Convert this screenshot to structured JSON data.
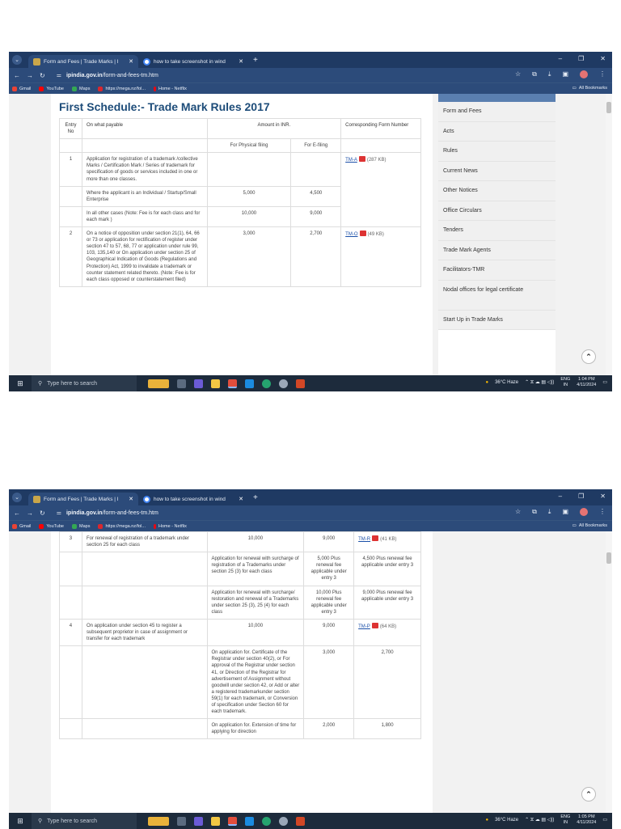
{
  "browser": {
    "tabs": [
      {
        "title": "Form and Fees | Trade Marks | I",
        "active": true
      },
      {
        "title": "how to take screenshot in wind",
        "active": false
      }
    ],
    "url_host": "ipindia.gov.in",
    "url_path": "/form-and-fees-tm.htm",
    "bookmarks": [
      "Gmail",
      "YouTube",
      "Maps",
      "https://mega.nz/fol...",
      "Home - Netflix"
    ],
    "all_bookmarks": "All Bookmarks"
  },
  "page1": {
    "heading": "First Schedule:- Trade Mark Rules 2017",
    "headers": {
      "entry": "Entry No",
      "what": "On what payable",
      "amount": "Amount in INR.",
      "form": "Corresponding Form Number",
      "physical": "For Physical filing",
      "efiling": "For E-filing"
    },
    "rows": [
      {
        "no": "1",
        "what": "Application for registration of a trademark /collective Marks / Certification Mark / Series of trademark for specification of goods or services included in one or more than one classes.",
        "phys": "",
        "efile": "",
        "form": "TM-A",
        "size": "(287 KB)"
      },
      {
        "no": "",
        "what": "Where the applicant is an Individual / Startup/Small Enterprise",
        "phys": "5,000",
        "efile": "4,500",
        "form": "",
        "size": ""
      },
      {
        "no": "",
        "what": "In all other cases (Note: Fee is for each class and for each mark )",
        "phys": "10,000",
        "efile": "9,000",
        "form": "",
        "size": ""
      },
      {
        "no": "2",
        "what": "On a notice of opposition under section 21(1), 64, 66 or 73 or application for rectification of register under section 47 to 57, 68, 77 or application under rule 99, 103, 135,140 or On application under section 25 of Geographical Indication of Goods (Regulations and Protection) Act, 1999 to invalidate a trademark or counter statement related thereto. (Note: Fee is for each class opposed or counterstatement filed)",
        "phys": "3,000",
        "efile": "2,700",
        "form": "TM-O",
        "size": "(49 KB)"
      }
    ]
  },
  "sidebar": [
    "Form and Fees",
    "Acts",
    "Rules",
    "Current News",
    "Other Notices",
    "Office Circulars",
    "Tenders",
    "Trade Mark Agents",
    "Facilitators-TMR",
    "Nodal offices for legal certificate",
    "Start Up in Trade Marks"
  ],
  "page2": {
    "rows": [
      {
        "no": "3",
        "what": "For renewal of registration of a trademark under section 25 for each class",
        "phys": "10,000",
        "efile": "9,000",
        "form": "TM-R",
        "size": "(41 KB)"
      },
      {
        "no": "",
        "what": "Application for renewal with surcharge of registration of a Trademarks under section 25 (3) for each class",
        "phys": "5,000 Plus renewal fee applicable under entry 3",
        "efile": "4,500 Plus renewal fee applicable under entry 3",
        "form": "",
        "size": ""
      },
      {
        "no": "",
        "what": "Application for renewal with surcharge/ restoration and renewal of a Trademarks under section 25 (3), 25 (4) for each class",
        "phys": "10,000 Plus renewal fee applicable under entry 3",
        "efile": "9,000 Plus renewal fee applicable under entry 3",
        "form": "",
        "size": ""
      },
      {
        "no": "4",
        "what": "On application under section 45 to register a subsequent proprietor in case of assignment or transfer for each trademark",
        "phys": "10,000",
        "efile": "9,000",
        "form": "TM-P",
        "size": "(64 KB)"
      },
      {
        "no": "",
        "what": "On application for. Certificate of the Registrar under section 40(2), or For approval of the Registrar under section 41, or Direction of the Registrar for advertisement of Assignment without goodwill under section 42, or Add or alter a registered trademarkunder section 59(1) for each trademark, or Conversion of specification under Section 60 for each trademark.",
        "phys": "3,000",
        "efile": "2,700",
        "form": "",
        "size": ""
      },
      {
        "no": "",
        "what": "On application for. Extension of time for applying for direction",
        "phys": "2,000",
        "efile": "1,800",
        "form": "",
        "size": ""
      }
    ]
  },
  "taskbar": {
    "search": "Type here to search",
    "weather": "36°C Haze",
    "lang1": "ENG",
    "lang2": "IN",
    "time1": "1:04 PM",
    "time2": "1:05 PM",
    "date": "4/11/2024"
  }
}
